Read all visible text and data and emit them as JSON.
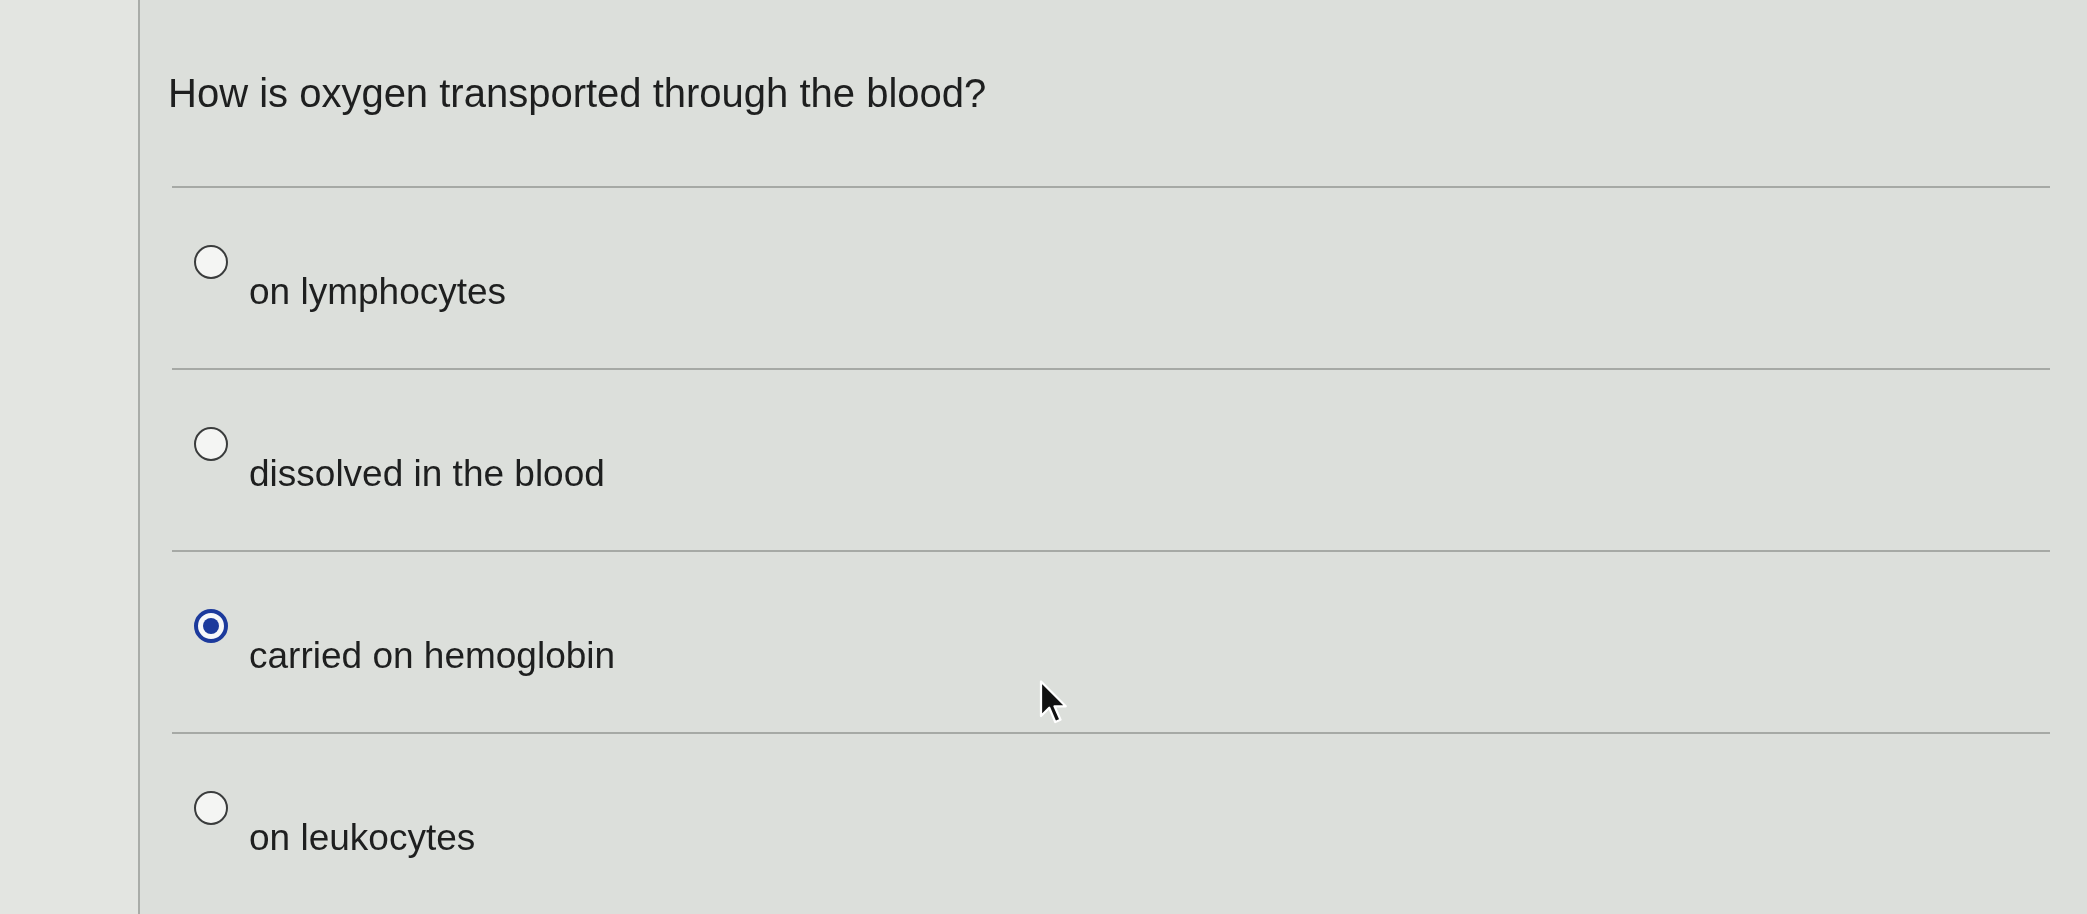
{
  "question": {
    "text": "How is oxygen transported through the blood?"
  },
  "options": [
    {
      "label": "on lymphocytes",
      "selected": false
    },
    {
      "label": "dissolved in the blood",
      "selected": false
    },
    {
      "label": "carried on hemoglobin",
      "selected": true
    },
    {
      "label": "on leukocytes",
      "selected": false
    }
  ]
}
